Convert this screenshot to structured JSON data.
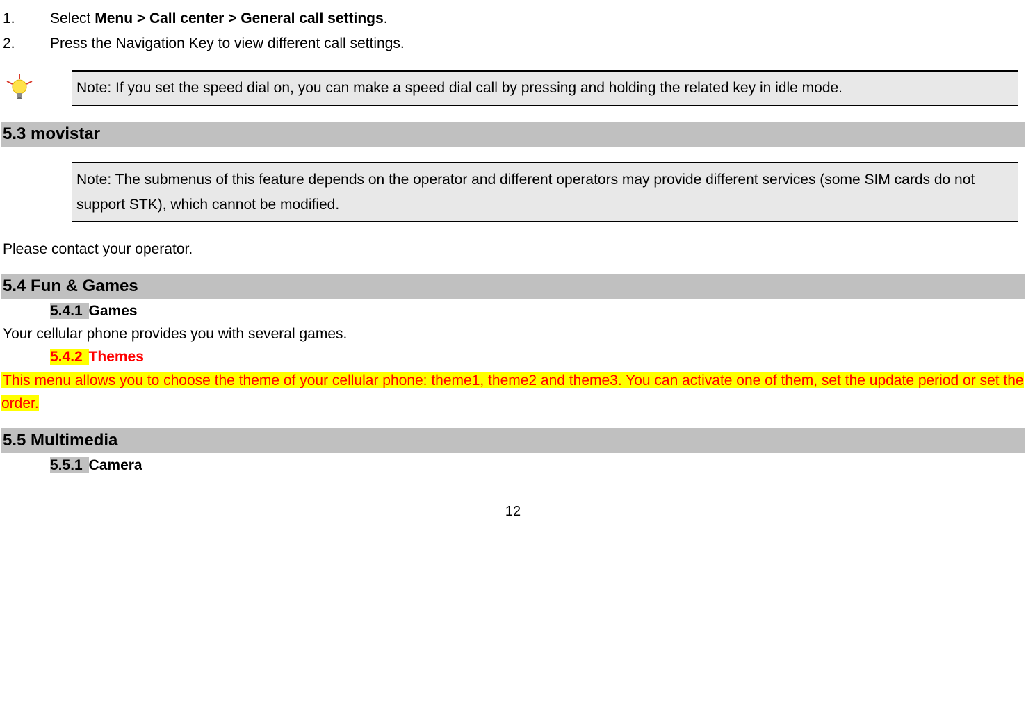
{
  "steps": [
    {
      "num": "1.",
      "prefix": "Select ",
      "bold": "Menu > Call center > General call settings",
      "suffix": "."
    },
    {
      "num": "2.",
      "text": "Press the Navigation Key to view different call settings."
    }
  ],
  "note1": "Note: If you set the speed dial on, you can make a speed dial call by pressing and holding the related key in idle mode.",
  "s53": {
    "heading": "5.3 movistar"
  },
  "note2": "Note: The submenus of this feature depends on the operator and different operators may provide different services (some SIM cards do not support STK), which cannot be modified.",
  "contact": "Please contact your operator.",
  "s54": {
    "heading": "5.4 Fun & Games",
    "s541": {
      "num": "5.4.1 ",
      "title": "Games",
      "body": "Your cellular phone provides you with several games."
    },
    "s542": {
      "num": "5.4.2 ",
      "title": "Themes",
      "body": "This menu allows you to choose the theme of your cellular phone: theme1, theme2 and theme3. You can activate one of them, set the update period or set the order."
    }
  },
  "s55": {
    "heading": "5.5 Multimedia",
    "s551": {
      "num": "5.5.1 ",
      "title": "Camera"
    }
  },
  "page_number": "12"
}
